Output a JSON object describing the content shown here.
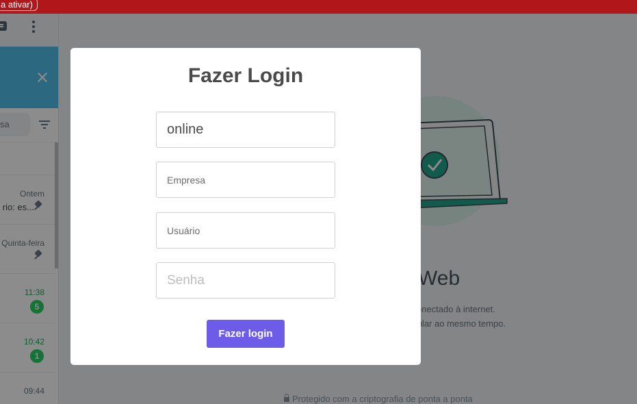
{
  "topbar": {
    "pill_text": "a ativar)",
    "color": "#b0161a"
  },
  "sidebar": {
    "search_placeholder": "sa",
    "chats": [
      {
        "time": "",
        "preview": "",
        "pinned": false,
        "badge": ""
      },
      {
        "time": "Ontem",
        "preview": "rio: es...",
        "pinned": true,
        "badge": ""
      },
      {
        "time": "Quinta-feira",
        "preview": "",
        "pinned": true,
        "badge": ""
      },
      {
        "time": "11:38",
        "preview": "",
        "pinned": false,
        "badge": "5"
      },
      {
        "time": "10:42",
        "preview": "",
        "pinned": false,
        "badge": "1"
      },
      {
        "time": "09:44",
        "preview": "",
        "pinned": false,
        "badge": ""
      }
    ]
  },
  "intro": {
    "title": "Web",
    "line1": "seu celular conectado à internet.",
    "line2": "dos e um celular ao mesmo tempo.",
    "footer": "Protegido com a criptografia de ponta a ponta"
  },
  "login": {
    "title": "Fazer Login",
    "field1_value": "online",
    "empresa_placeholder": "Empresa",
    "usuario_placeholder": "Usuário",
    "senha_placeholder": "Senha",
    "button_label": "Fazer login",
    "button_color": "#6c5ce7"
  },
  "icons": [
    "chat-icon",
    "menu-icon",
    "close-icon",
    "filter-icon",
    "pin-icon",
    "lock-icon",
    "check-icon",
    "laptop-icon"
  ]
}
